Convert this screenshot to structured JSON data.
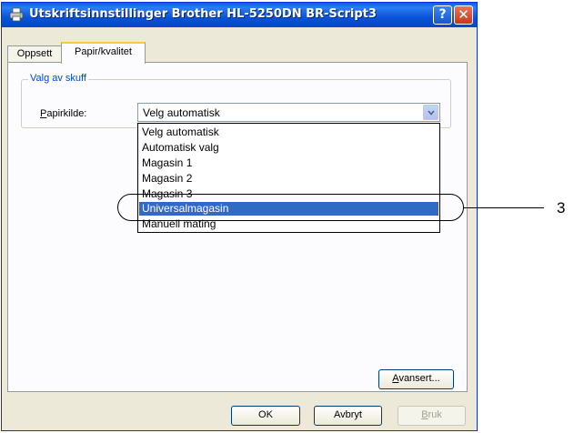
{
  "window": {
    "title": "Utskriftsinnstillinger Brother HL-5250DN BR-Script3",
    "help_glyph": "?",
    "close_glyph": "✕",
    "icon": "printer-icon"
  },
  "tabs": [
    {
      "label": "Oppsett",
      "active": false
    },
    {
      "label": "Papir/kvalitet",
      "active": true
    }
  ],
  "tray_group": {
    "legend": "Valg av skuff",
    "field_label": "Papirkilde:",
    "selected_value": "Velg automatisk",
    "options": [
      {
        "label": "Velg automatisk"
      },
      {
        "label": "Automatisk valg"
      },
      {
        "label": "Magasin 1"
      },
      {
        "label": "Magasin 2"
      },
      {
        "label": "Magasin 3"
      },
      {
        "label": "Universalmagasin",
        "highlighted": true
      },
      {
        "label": "Manuell mating"
      }
    ]
  },
  "callout": {
    "number": "3"
  },
  "buttons": {
    "advanced": "Avansert...",
    "ok": "OK",
    "cancel": "Avbryt",
    "apply": "Bruk"
  },
  "colors": {
    "titlebar": "#0a53d8",
    "selection": "#316ac5",
    "group_legend": "#0046d5"
  }
}
